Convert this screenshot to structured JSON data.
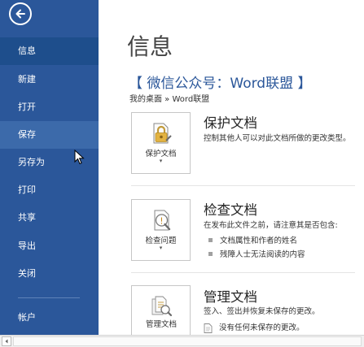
{
  "sidebar": {
    "items": [
      {
        "label": "信息",
        "state": "selected"
      },
      {
        "label": "新建"
      },
      {
        "label": "打开"
      },
      {
        "label": "保存",
        "state": "hover"
      },
      {
        "label": "另存为"
      },
      {
        "label": "打印"
      },
      {
        "label": "共享"
      },
      {
        "label": "导出"
      },
      {
        "label": "关闭"
      },
      {
        "label": "帐户"
      }
    ],
    "bg_color": "#2b579a"
  },
  "main": {
    "title": "信息",
    "promo": "【 微信公众号：Word联盟 】",
    "breadcrumb": "我的桌面 » Word联盟",
    "sections": [
      {
        "tile_label": "保护文档",
        "title": "保护文档",
        "desc": "控制其他人可以对此文档所做的更改类型。",
        "icon": "lock-document-icon"
      },
      {
        "tile_label": "检查问题",
        "title": "检查文档",
        "desc": "在发布此文件之前，请注意其是否包含:",
        "bullets": [
          "文档属性和作者的姓名",
          "残障人士无法阅读的内容"
        ],
        "icon": "inspect-document-icon"
      },
      {
        "tile_label": "管理文档",
        "title": "管理文档",
        "desc": "签入、签出并恢复未保存的更改。",
        "doc_line": "没有任何未保存的更改。",
        "icon": "manage-versions-icon"
      }
    ]
  },
  "accent_color": "#2b579a"
}
